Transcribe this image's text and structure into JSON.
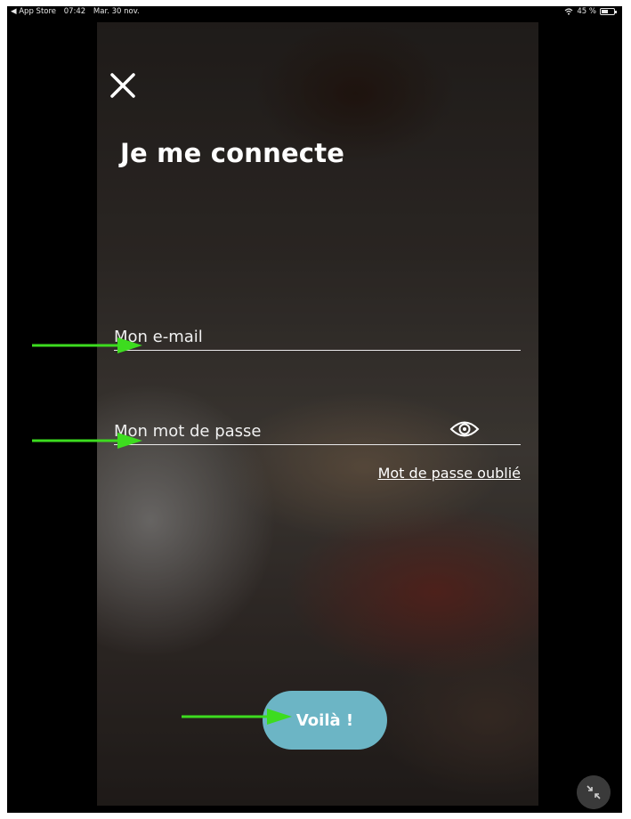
{
  "status_bar": {
    "back_app": "◀ App Store",
    "time": "07:42",
    "date": "Mar. 30 nov.",
    "battery": "45 %"
  },
  "login": {
    "title": "Je me connecte",
    "email_placeholder": "Mon e-mail",
    "password_placeholder": "Mon mot de passe",
    "forgot_password": "Mot de passe oublié",
    "submit_label": "Voilà !"
  },
  "colors": {
    "accent_button": "#6cb5c5",
    "annotation_arrow": "#3ddc1f"
  },
  "icons": [
    "close-icon",
    "eye-icon",
    "wifi-icon",
    "battery-icon",
    "collapse-icon"
  ]
}
